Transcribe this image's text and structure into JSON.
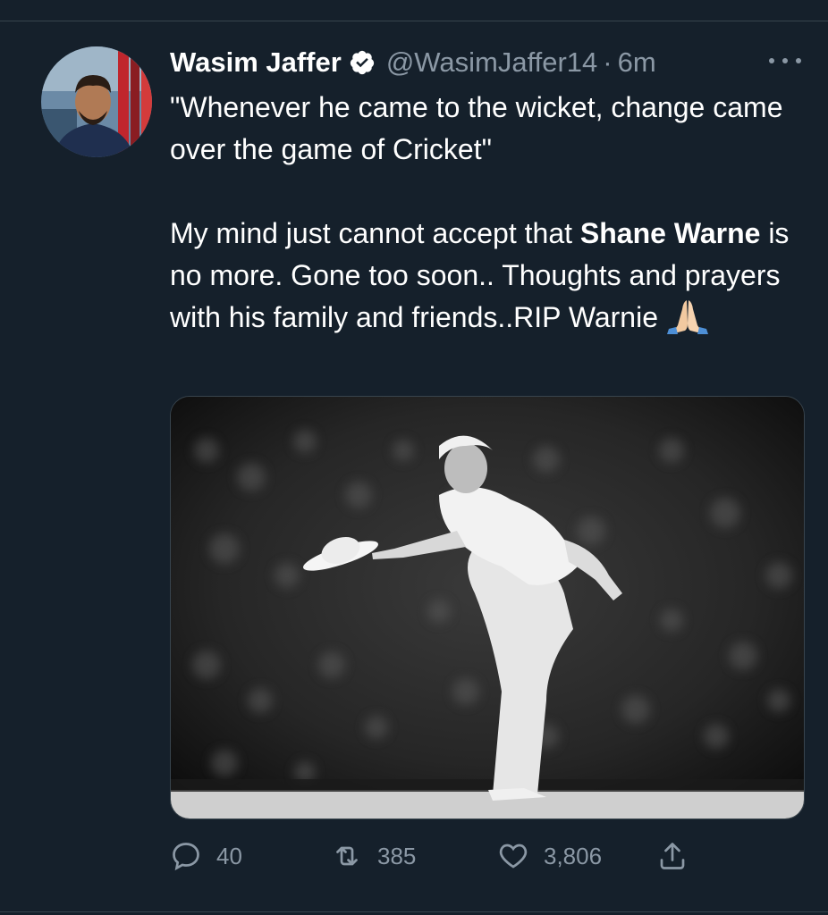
{
  "tweet": {
    "author": {
      "name": "Wasim Jaffer",
      "handle": "@WasimJaffer14",
      "verified": true
    },
    "separator": "·",
    "time": "6m",
    "text": {
      "quote": "\"Whenever he came to the wicket, change came over the game of Cricket\"",
      "line_pre": "My mind just cannot accept that ",
      "bold_name": "Shane Warne",
      "line_post": " is no more. Gone too soon.. Thoughts and prayers with his family and friends..RIP Warnie"
    },
    "media": {
      "icon": "cricketer-bowing-photo"
    },
    "actions": {
      "replies": "40",
      "retweets": "385",
      "likes": "3,806"
    }
  },
  "colors": {
    "background": "#15202b",
    "text": "#ffffff",
    "secondary": "#8b98a5",
    "verified": "#ffffff",
    "divider": "#38444d"
  }
}
